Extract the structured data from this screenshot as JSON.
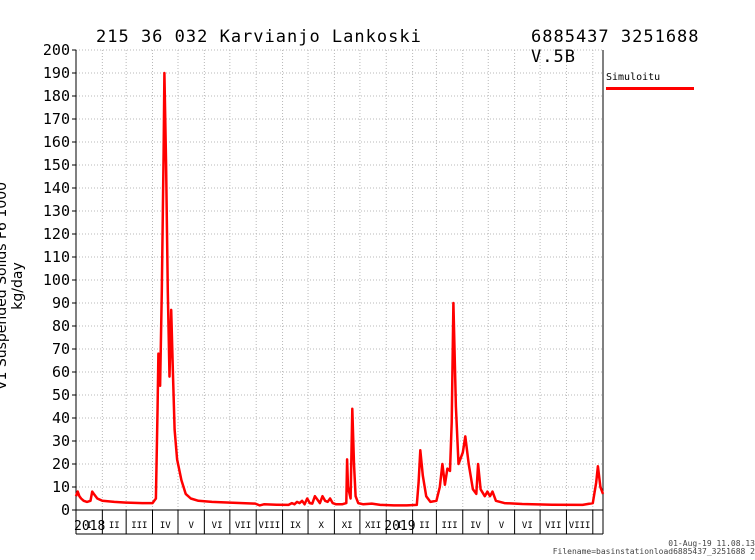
{
  "chart_data": {
    "type": "line",
    "title_left": "215 36 032 Karvianjo Lankoski",
    "title_right": "6885437 3251688 V.5B",
    "ylabel": "V1 Suspended Solids F6 1000 kg/day",
    "ylim": [
      0,
      200
    ],
    "yticks": [
      "0",
      "10",
      "20",
      "30",
      "40",
      "50",
      "60",
      "70",
      "80",
      "90",
      "100",
      "110",
      "120",
      "130",
      "140",
      "150",
      "160",
      "170",
      "180",
      "190",
      "200"
    ],
    "xlim": [
      "2018-01-01",
      "2019-09-13"
    ],
    "grid": true,
    "legend_position": "top-right",
    "month_labels": [
      "I",
      "II",
      "III",
      "IV",
      "V",
      "VI",
      "VII",
      "VIII",
      "IX",
      "X",
      "XI",
      "XII",
      "I",
      "II",
      "III",
      "IV",
      "V",
      "VI",
      "VII",
      "VIII"
    ],
    "year_labels": [
      {
        "text": "2018",
        "date": "2018-01-01"
      },
      {
        "text": "2019",
        "date": "2019-01-01"
      }
    ],
    "series": [
      {
        "name": "Simuloitu",
        "color": "#ff0000",
        "points": [
          [
            "2018-01-01",
            6
          ],
          [
            "2018-01-03",
            8
          ],
          [
            "2018-01-05",
            6
          ],
          [
            "2018-01-07",
            5
          ],
          [
            "2018-01-10",
            4
          ],
          [
            "2018-01-14",
            3.5
          ],
          [
            "2018-01-18",
            4
          ],
          [
            "2018-01-20",
            8
          ],
          [
            "2018-01-22",
            7
          ],
          [
            "2018-01-26",
            5
          ],
          [
            "2018-02-01",
            4
          ],
          [
            "2018-02-15",
            3.5
          ],
          [
            "2018-03-01",
            3.2
          ],
          [
            "2018-03-20",
            3
          ],
          [
            "2018-04-01",
            3
          ],
          [
            "2018-04-05",
            5
          ],
          [
            "2018-04-07",
            45
          ],
          [
            "2018-04-08",
            68
          ],
          [
            "2018-04-10",
            54
          ],
          [
            "2018-04-12",
            95
          ],
          [
            "2018-04-14",
            155
          ],
          [
            "2018-04-15",
            190
          ],
          [
            "2018-04-17",
            150
          ],
          [
            "2018-04-19",
            95
          ],
          [
            "2018-04-21",
            58
          ],
          [
            "2018-04-23",
            87
          ],
          [
            "2018-04-25",
            60
          ],
          [
            "2018-04-27",
            35
          ],
          [
            "2018-04-30",
            22
          ],
          [
            "2018-05-05",
            13
          ],
          [
            "2018-05-10",
            7
          ],
          [
            "2018-05-16",
            5
          ],
          [
            "2018-05-25",
            4
          ],
          [
            "2018-06-10",
            3.5
          ],
          [
            "2018-07-01",
            3.2
          ],
          [
            "2018-07-31",
            2.8
          ],
          [
            "2018-08-05",
            2
          ],
          [
            "2018-08-10",
            2.5
          ],
          [
            "2018-08-25",
            2.3
          ],
          [
            "2018-09-08",
            2.2
          ],
          [
            "2018-09-12",
            3
          ],
          [
            "2018-09-15",
            2.5
          ],
          [
            "2018-09-18",
            3.5
          ],
          [
            "2018-09-21",
            3
          ],
          [
            "2018-09-24",
            4
          ],
          [
            "2018-09-27",
            2.5
          ],
          [
            "2018-09-30",
            5
          ],
          [
            "2018-10-03",
            3
          ],
          [
            "2018-10-06",
            2.8
          ],
          [
            "2018-10-09",
            6
          ],
          [
            "2018-10-12",
            4.5
          ],
          [
            "2018-10-15",
            3
          ],
          [
            "2018-10-18",
            6
          ],
          [
            "2018-10-21",
            4
          ],
          [
            "2018-10-24",
            3.5
          ],
          [
            "2018-10-27",
            5
          ],
          [
            "2018-10-30",
            3
          ],
          [
            "2018-11-03",
            2.5
          ],
          [
            "2018-11-10",
            2.5
          ],
          [
            "2018-11-15",
            3
          ],
          [
            "2018-11-16",
            22
          ],
          [
            "2018-11-17",
            10
          ],
          [
            "2018-11-20",
            5
          ],
          [
            "2018-11-22",
            44
          ],
          [
            "2018-11-24",
            20
          ],
          [
            "2018-11-26",
            6
          ],
          [
            "2018-11-29",
            3
          ],
          [
            "2018-12-05",
            2.5
          ],
          [
            "2018-12-15",
            2.8
          ],
          [
            "2018-12-25",
            2.2
          ],
          [
            "2019-01-10",
            2
          ],
          [
            "2019-01-25",
            2
          ],
          [
            "2019-02-06",
            2.2
          ],
          [
            "2019-02-08",
            12
          ],
          [
            "2019-02-10",
            26
          ],
          [
            "2019-02-13",
            15
          ],
          [
            "2019-02-17",
            6
          ],
          [
            "2019-02-22",
            3.5
          ],
          [
            "2019-03-01",
            4
          ],
          [
            "2019-03-05",
            10
          ],
          [
            "2019-03-08",
            20
          ],
          [
            "2019-03-11",
            11
          ],
          [
            "2019-03-14",
            18
          ],
          [
            "2019-03-17",
            17
          ],
          [
            "2019-03-19",
            38
          ],
          [
            "2019-03-21",
            90
          ],
          [
            "2019-03-24",
            45
          ],
          [
            "2019-03-27",
            20
          ],
          [
            "2019-04-01",
            25
          ],
          [
            "2019-04-04",
            32
          ],
          [
            "2019-04-08",
            20
          ],
          [
            "2019-04-13",
            9
          ],
          [
            "2019-04-17",
            7
          ],
          [
            "2019-04-19",
            20
          ],
          [
            "2019-04-22",
            9
          ],
          [
            "2019-04-27",
            6
          ],
          [
            "2019-04-30",
            8
          ],
          [
            "2019-05-03",
            6
          ],
          [
            "2019-05-06",
            8
          ],
          [
            "2019-05-10",
            4
          ],
          [
            "2019-05-20",
            3
          ],
          [
            "2019-06-10",
            2.6
          ],
          [
            "2019-07-15",
            2.3
          ],
          [
            "2019-08-20",
            2.2
          ],
          [
            "2019-09-01",
            3
          ],
          [
            "2019-09-05",
            12
          ],
          [
            "2019-09-07",
            19
          ],
          [
            "2019-09-10",
            10
          ],
          [
            "2019-09-13",
            7
          ]
        ]
      }
    ]
  },
  "footer": {
    "date_line": "01-Aug-19 11.08.13",
    "file_line": "Filename=basinstationload6885437_3251688 2"
  }
}
